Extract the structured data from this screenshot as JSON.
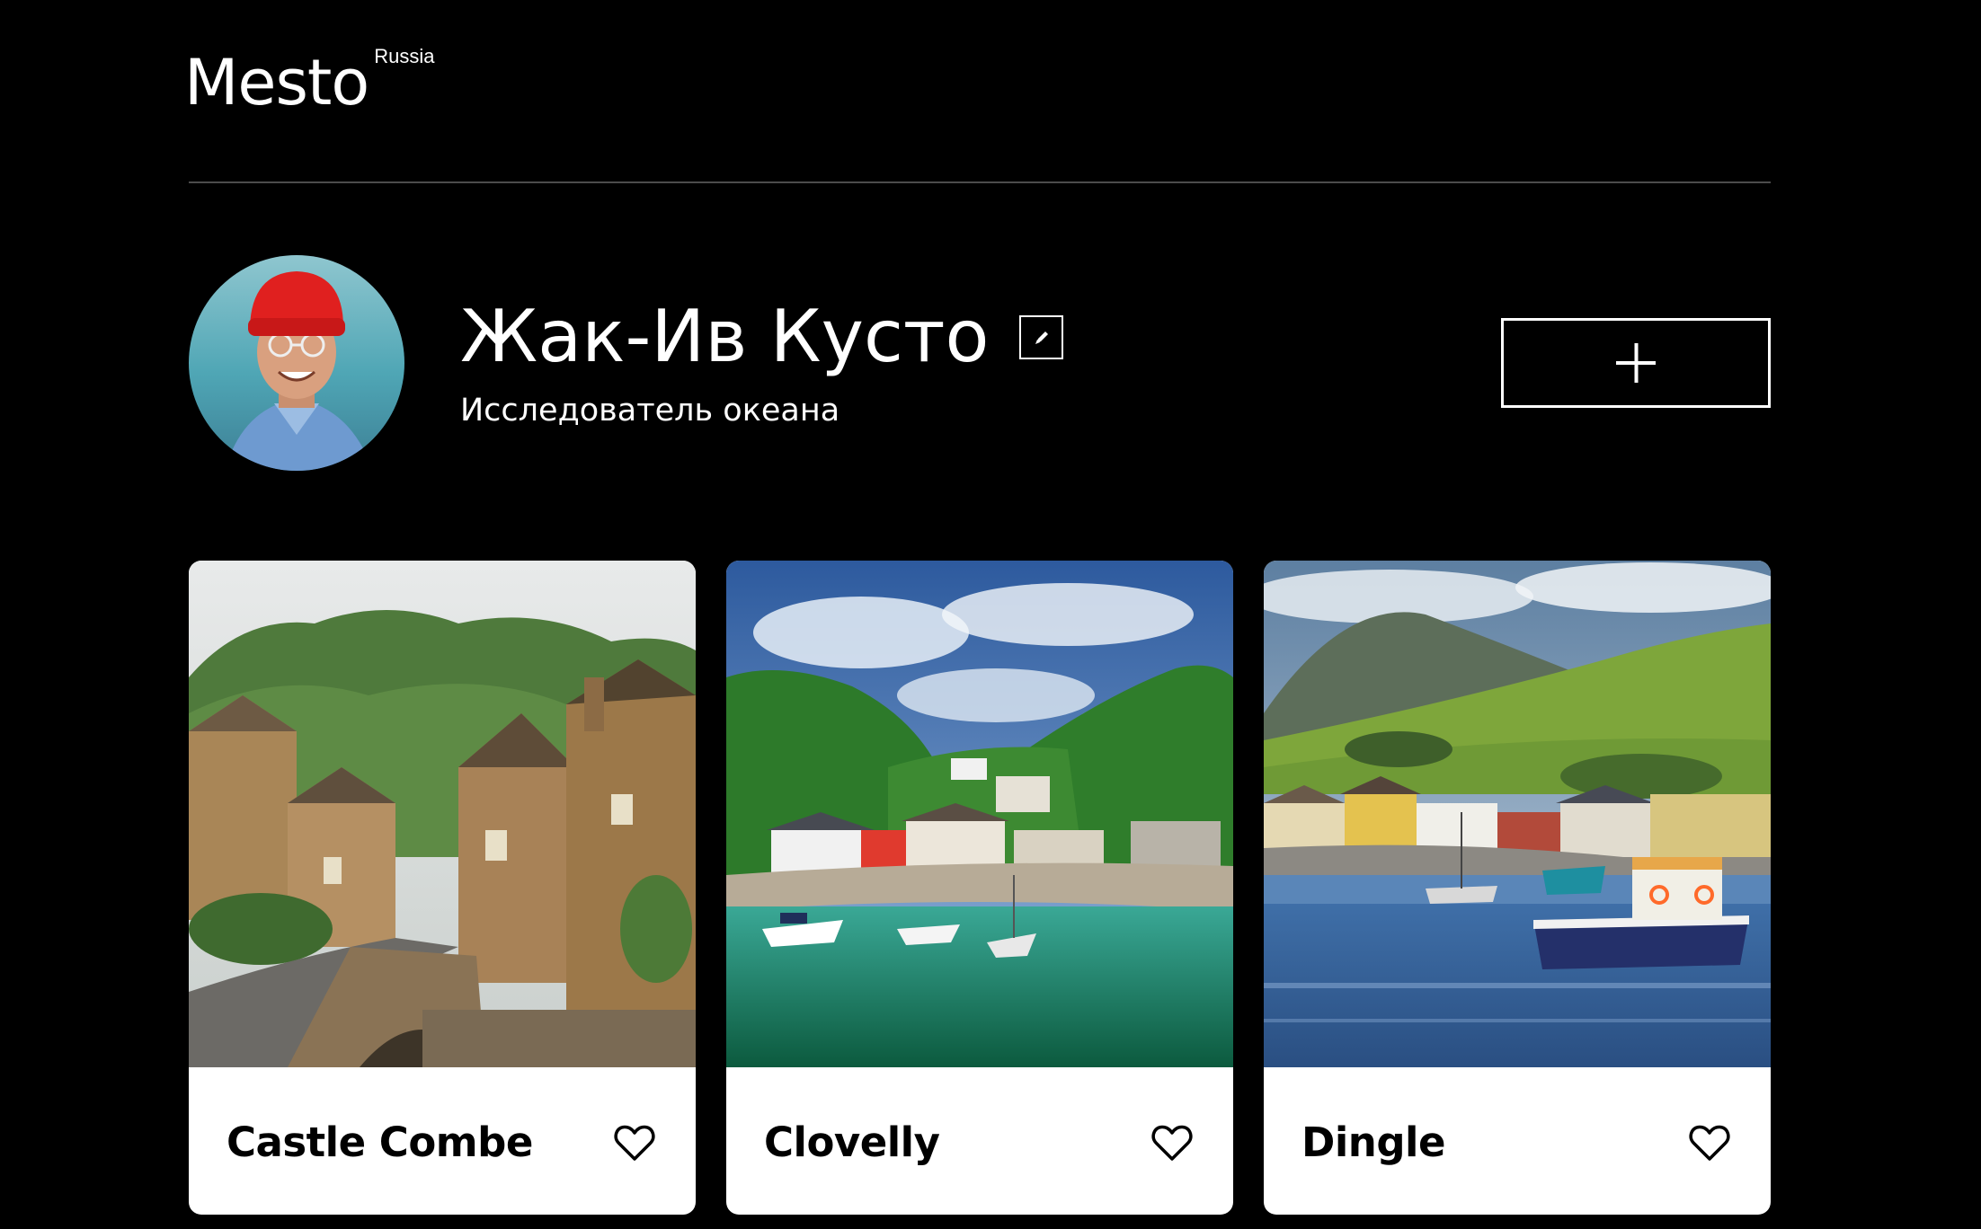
{
  "header": {
    "logo": "Mesto",
    "logo_sup": "Russia"
  },
  "profile": {
    "name": "Жак-Ив Кусто",
    "about": "Исследователь океана",
    "avatar_icon": "avatar-photo"
  },
  "buttons": {
    "edit_icon": "pencil-icon",
    "add_icon": "plus-icon"
  },
  "cards": [
    {
      "title": "Castle Combe",
      "like_icon": "heart-icon",
      "liked": false
    },
    {
      "title": "Clovelly",
      "like_icon": "heart-icon",
      "liked": false
    },
    {
      "title": "Dingle",
      "like_icon": "heart-icon",
      "liked": false
    }
  ],
  "colors": {
    "background": "#000000",
    "text": "#ffffff",
    "card": "#ffffff",
    "card_text": "#000000",
    "divider": "#545454"
  }
}
